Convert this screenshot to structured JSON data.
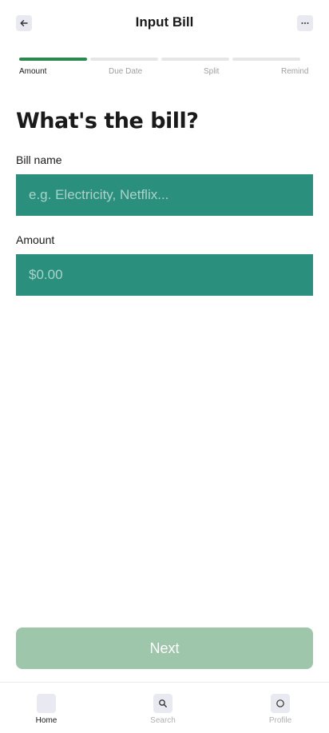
{
  "header": {
    "title": "Input Bill",
    "back_icon": "arrow-left-icon",
    "more_icon": "ellipsis-icon"
  },
  "stepper": {
    "active_index": 0,
    "steps": [
      "Amount",
      "Due Date",
      "Split",
      "Remind"
    ]
  },
  "form": {
    "heading": "What's the bill?",
    "bill_name": {
      "label": "Bill name",
      "placeholder": "e.g. Electricity, Netflix...",
      "value": ""
    },
    "amount": {
      "label": "Amount",
      "placeholder": "$0.00",
      "value": ""
    }
  },
  "actions": {
    "next_label": "Next"
  },
  "tabbar": {
    "active": "Home",
    "tabs": [
      {
        "label": "Home",
        "icon": "home-icon"
      },
      {
        "label": "Search",
        "icon": "search-icon"
      },
      {
        "label": "Profile",
        "icon": "profile-icon"
      }
    ]
  },
  "colors": {
    "accent": "#2a8a4e",
    "field_bg": "#2a8f7c",
    "button_disabled": "#9dc6ab"
  }
}
